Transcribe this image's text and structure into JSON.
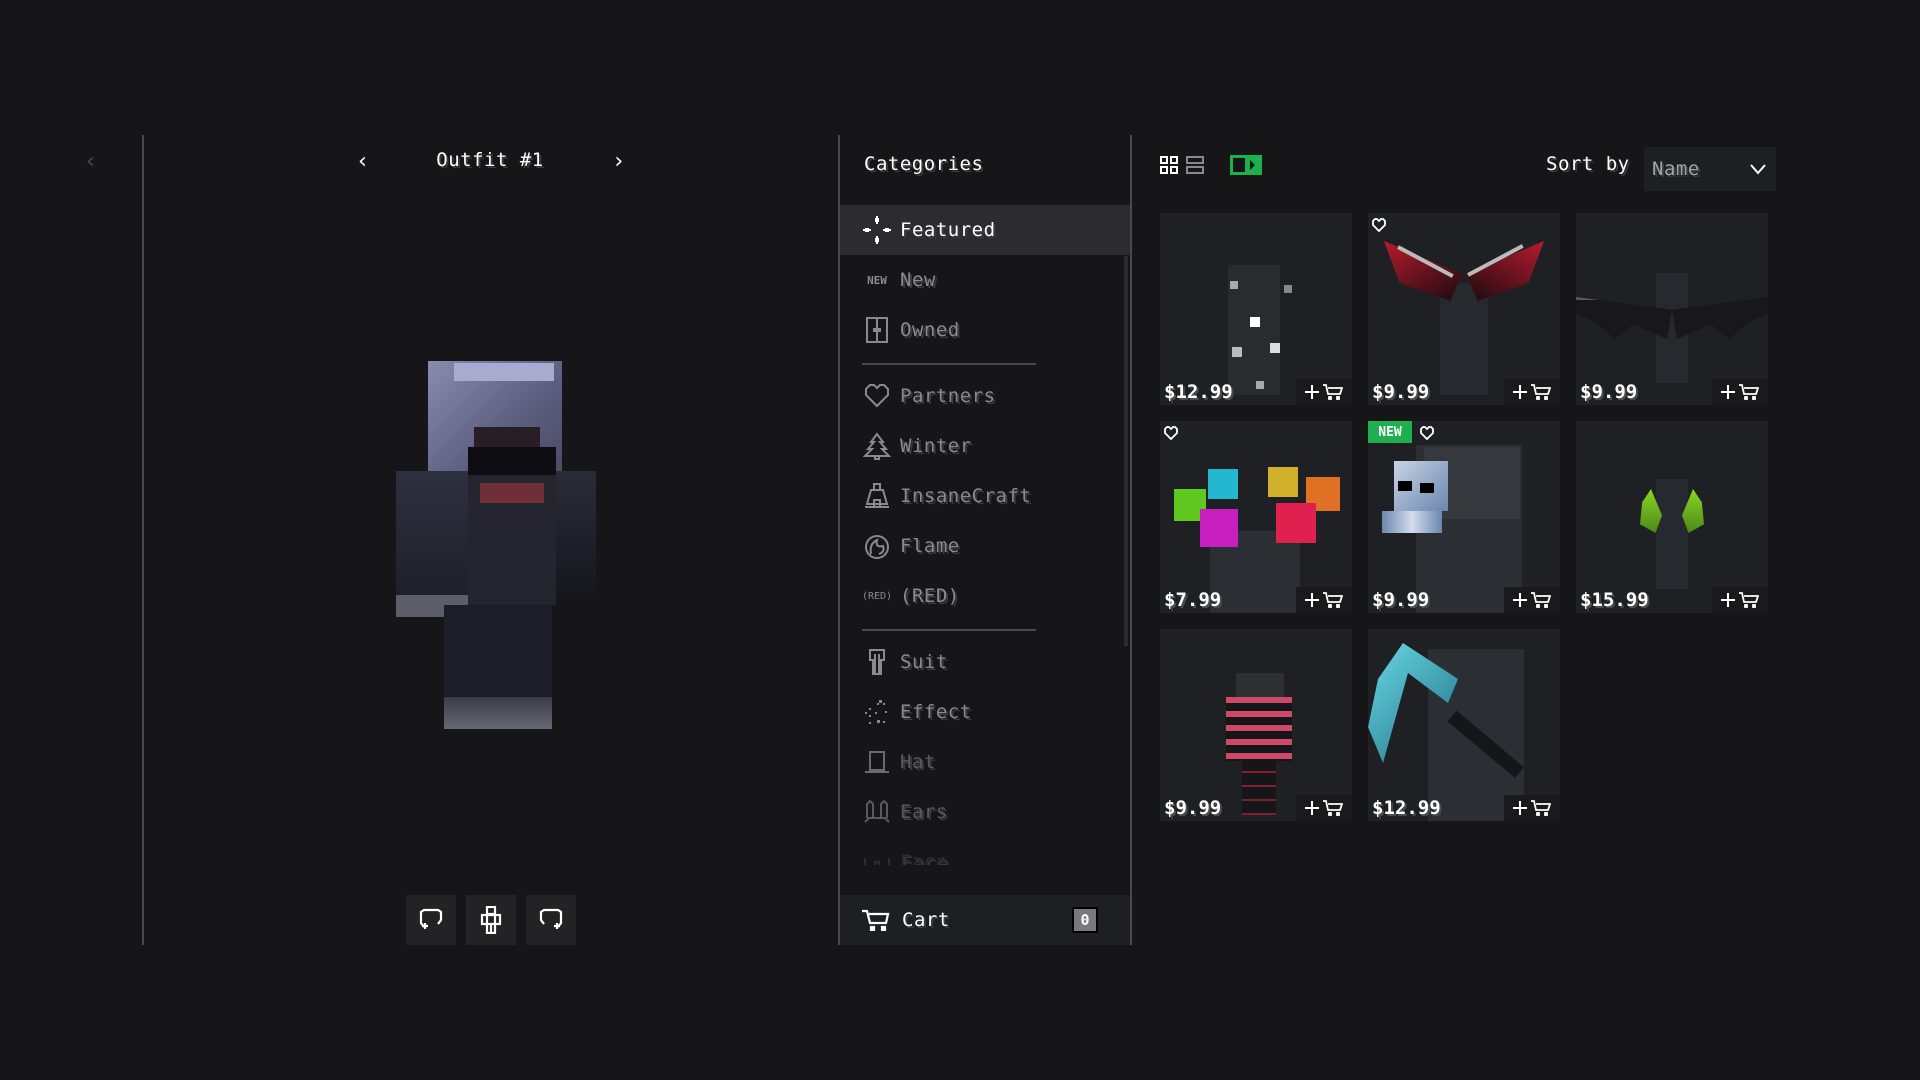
{
  "outfit": {
    "title": "Outfit #1",
    "back_icon": "chevron-left-icon",
    "prev_icon": "chevron-left-icon",
    "next_icon": "chevron-right-icon",
    "controls": [
      {
        "name": "rotate-left",
        "icon": "rotate-left-icon"
      },
      {
        "name": "pose",
        "icon": "character-icon"
      },
      {
        "name": "rotate-right",
        "icon": "rotate-right-icon"
      }
    ]
  },
  "categories": {
    "title": "Categories",
    "items": [
      {
        "label": "Featured",
        "icon": "featured-sparkle-icon",
        "active": true
      },
      {
        "label": "New",
        "icon": "new-text-icon",
        "icon_text": "NEW"
      },
      {
        "label": "Owned",
        "icon": "wardrobe-icon"
      },
      {
        "label": "Partners",
        "icon": "heart-icon"
      },
      {
        "label": "Winter",
        "icon": "tree-icon"
      },
      {
        "label": "InsaneCraft",
        "icon": "insanecraft-icon"
      },
      {
        "label": "Flame",
        "icon": "flame-icon"
      },
      {
        "label": "(RED)",
        "icon": "red-text-icon",
        "icon_text": "(RED)"
      },
      {
        "label": "Suit",
        "icon": "suit-icon"
      },
      {
        "label": "Effect",
        "icon": "effect-sparkle-icon"
      },
      {
        "label": "Hat",
        "icon": "hat-icon"
      },
      {
        "label": "Ears",
        "icon": "ears-icon"
      },
      {
        "label": "Face",
        "icon": "glasses-icon"
      }
    ],
    "cart": {
      "label": "Cart",
      "count": "0",
      "icon": "cart-icon"
    }
  },
  "store": {
    "view_modes": [
      {
        "name": "grid",
        "icon": "grid-view-icon",
        "active": true
      },
      {
        "name": "list",
        "icon": "list-view-icon",
        "active": false
      },
      {
        "name": "preview",
        "icon": "preview-toggle-icon",
        "active": true
      }
    ],
    "sort": {
      "label": "Sort by",
      "value": "Name"
    },
    "accent": "#1eb04e",
    "items": [
      {
        "name": "Sparkle Effect",
        "price": "$12.99",
        "new": false,
        "heart": false
      },
      {
        "name": "Crimson Wings",
        "price": "$9.99",
        "new": false,
        "heart": true
      },
      {
        "name": "Bat Wings",
        "price": "$9.99",
        "new": false,
        "heart": false
      },
      {
        "name": "Color Cubes",
        "price": "$7.99",
        "new": false,
        "heart": true
      },
      {
        "name": "Ice Pet",
        "price": "$9.99",
        "new": true,
        "heart": true,
        "badge": "NEW"
      },
      {
        "name": "Leaf Wings",
        "price": "$15.99",
        "new": false,
        "heart": false
      },
      {
        "name": "Crimson Suit",
        "price": "$9.99",
        "new": false,
        "heart": false
      },
      {
        "name": "Diamond Pickaxe",
        "price": "$12.99",
        "new": false,
        "heart": false
      }
    ],
    "add_icons": [
      "plus-icon",
      "cart-icon"
    ]
  }
}
